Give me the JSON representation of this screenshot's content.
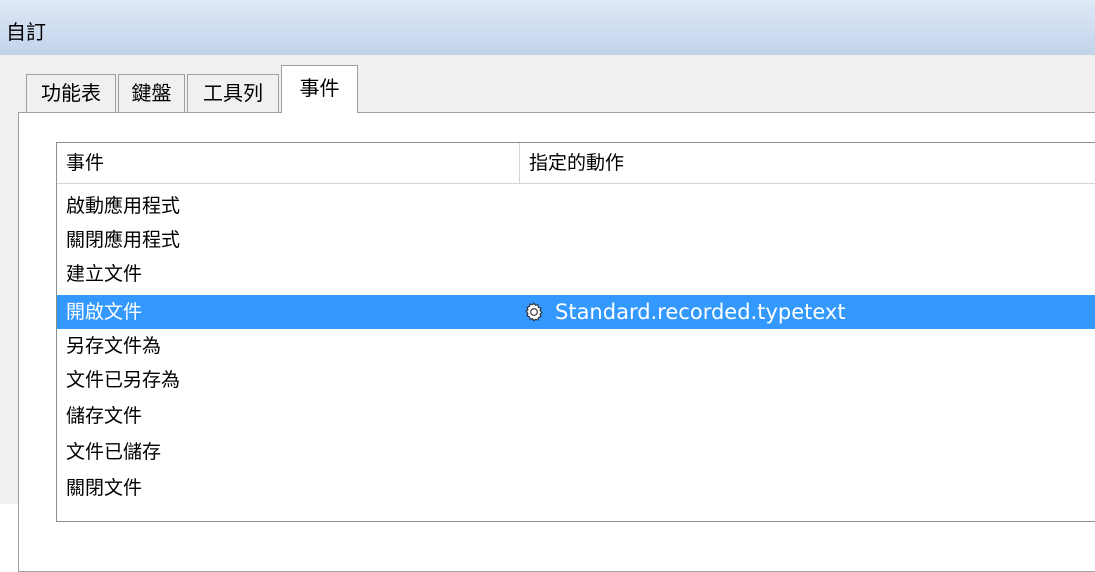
{
  "window": {
    "title": "自訂"
  },
  "tabs": [
    {
      "label": "功能表",
      "active": false
    },
    {
      "label": "鍵盤",
      "active": false
    },
    {
      "label": "工具列",
      "active": false
    },
    {
      "label": "事件",
      "active": true
    }
  ],
  "events_table": {
    "columns": [
      "事件",
      "指定的動作"
    ],
    "rows": [
      {
        "event": "啟動應用程式",
        "action": ""
      },
      {
        "event": "關閉應用程式",
        "action": ""
      },
      {
        "event": "建立文件",
        "action": ""
      },
      {
        "event": "開啟文件",
        "action": "Standard.recorded.typetext",
        "action_icon": "macro-gear-icon",
        "selected": true
      },
      {
        "event": "另存文件為",
        "action": ""
      },
      {
        "event": "文件已另存為",
        "action": ""
      },
      {
        "event": "儲存文件",
        "action": ""
      },
      {
        "event": "文件已儲存",
        "action": ""
      },
      {
        "event": "關閉文件",
        "action": ""
      }
    ]
  },
  "colors": {
    "selection": "#3399ff",
    "titlebar": "#c2d3ea"
  }
}
